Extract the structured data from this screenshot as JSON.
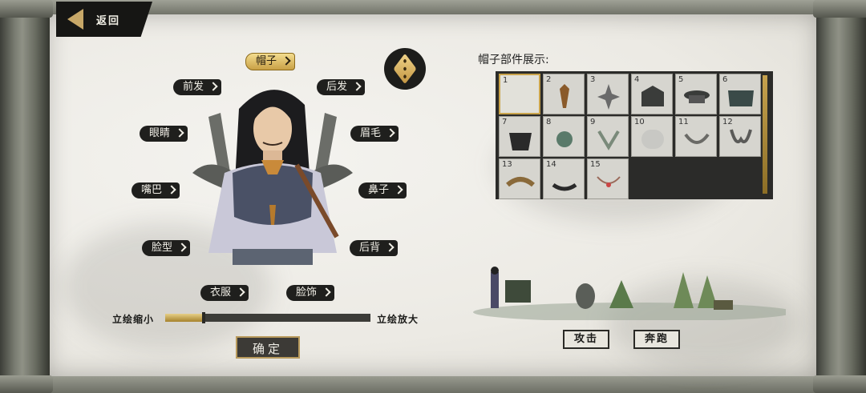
{
  "nav": {
    "back_label": "返回"
  },
  "parts": {
    "hat": "帽子",
    "front_hair": "前发",
    "back_hair": "后发",
    "eyes": "眼睛",
    "eyebrows": "眉毛",
    "mouth": "嘴巴",
    "nose": "鼻子",
    "face_shape": "脸型",
    "back": "后背",
    "clothes": "衣服",
    "face_ornament": "脸饰"
  },
  "slider": {
    "shrink_label": "立绘缩小",
    "enlarge_label": "立绘放大",
    "value": 0.18
  },
  "confirm_label": "确定",
  "grid": {
    "title": "帽子部件展示:",
    "selected": 1,
    "items": [
      "1",
      "2",
      "3",
      "4",
      "5",
      "6",
      "7",
      "8",
      "9",
      "10",
      "11",
      "12",
      "13",
      "14",
      "15"
    ]
  },
  "actions": {
    "attack_label": "攻击",
    "run_label": "奔跑"
  },
  "colors": {
    "accent_gold": "#c9a046",
    "tag_dark": "#1f1f1d",
    "paper": "#eceae4"
  }
}
